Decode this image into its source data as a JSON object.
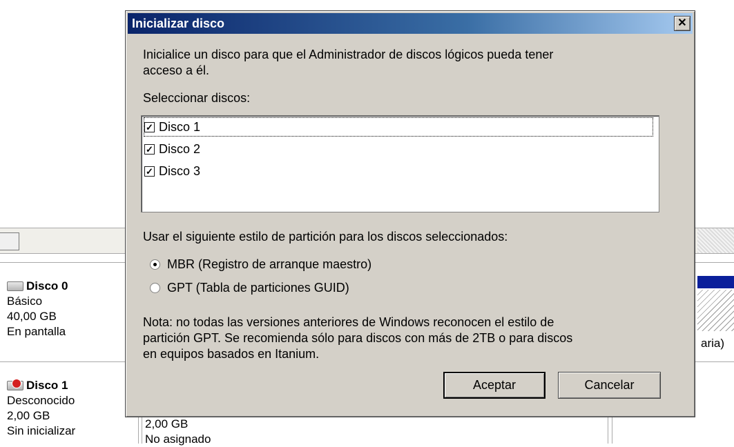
{
  "dialog": {
    "title": "Inicializar disco",
    "close_glyph": "✕",
    "intro_line1": "Inicialice un disco para que el Administrador de discos lógicos pueda tener",
    "intro_line2": "acceso a él.",
    "select_label": "Seleccionar discos:",
    "disks": [
      {
        "label": "Disco 1",
        "checked": true
      },
      {
        "label": "Disco 2",
        "checked": true
      },
      {
        "label": "Disco 3",
        "checked": true
      }
    ],
    "style_label": "Usar el siguiente estilo de partición para los discos seleccionados:",
    "options": [
      {
        "label": "MBR (Registro de arranque maestro)",
        "selected": true
      },
      {
        "label": "GPT (Tabla de particiones GUID)",
        "selected": false
      }
    ],
    "note_line1": "Nota: no todas las versiones anteriores de Windows reconocen el estilo de",
    "note_line2": "partición GPT. Se recomienda sólo para discos con más de 2TB o para discos",
    "note_line3": "en equipos basados en Itanium.",
    "ok_label": "Aceptar",
    "cancel_label": "Cancelar"
  },
  "background": {
    "disk0": {
      "name": "Disco 0",
      "type": "Básico",
      "size": "40,00 GB",
      "status": "En pantalla"
    },
    "disk1": {
      "name": "Disco 1",
      "type": "Desconocido",
      "size": "2,00 GB",
      "status": "Sin inicializar"
    },
    "disk1_volume_size": "2,00 GB",
    "disk1_volume_status": "No asignado",
    "partial_text": "aria)"
  },
  "colors": {
    "titlebar_start": "#0a246a",
    "titlebar_end": "#a6caf0",
    "dialog_bg": "#d4d0c8"
  }
}
